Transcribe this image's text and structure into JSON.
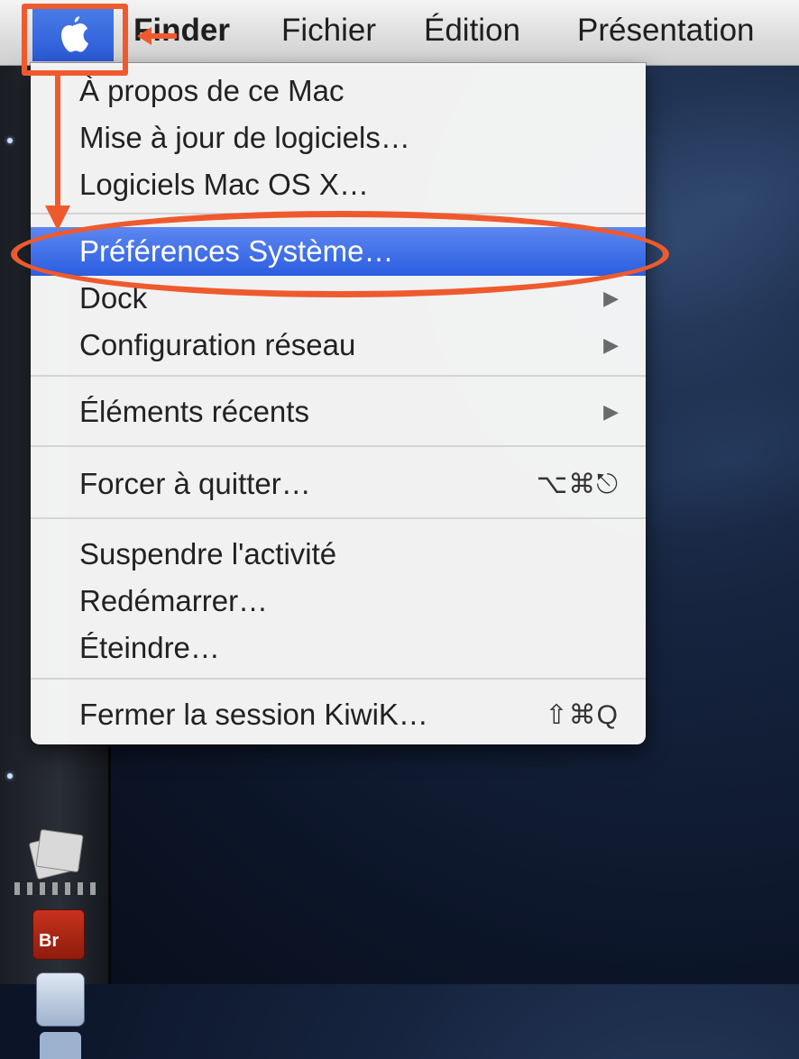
{
  "menubar": {
    "apple_label": "Apple",
    "items": [
      "Finder",
      "Fichier",
      "Édition",
      "Présentation"
    ]
  },
  "apple_menu": {
    "items": [
      {
        "label": "À propos de ce Mac",
        "shortcut": "",
        "submenu": false
      },
      {
        "label": "Mise à jour de logiciels…",
        "shortcut": "",
        "submenu": false
      },
      {
        "label": "Logiciels Mac OS X…",
        "shortcut": "",
        "submenu": false
      },
      {
        "label": "Préférences Système…",
        "shortcut": "",
        "submenu": false,
        "highlighted": true
      },
      {
        "label": "Dock",
        "shortcut": "",
        "submenu": true
      },
      {
        "label": "Configuration réseau",
        "shortcut": "",
        "submenu": true
      },
      {
        "label": "Éléments récents",
        "shortcut": "",
        "submenu": true
      },
      {
        "label": "Forcer à quitter…",
        "shortcut": "⌥⌘⎋",
        "submenu": false
      },
      {
        "label": "Suspendre l'activité",
        "shortcut": "",
        "submenu": false
      },
      {
        "label": "Redémarrer…",
        "shortcut": "",
        "submenu": false
      },
      {
        "label": "Éteindre…",
        "shortcut": "",
        "submenu": false
      },
      {
        "label": "Fermer la session KiwiK…",
        "shortcut": "⇧⌘Q",
        "submenu": false
      }
    ],
    "submenu_glyph": "▶"
  },
  "dock": {
    "br_icon_label": "Br"
  },
  "colors": {
    "highlight": "#2b5de0",
    "annotation": "#ee5a2e",
    "menubar": "#dcdcdc"
  }
}
